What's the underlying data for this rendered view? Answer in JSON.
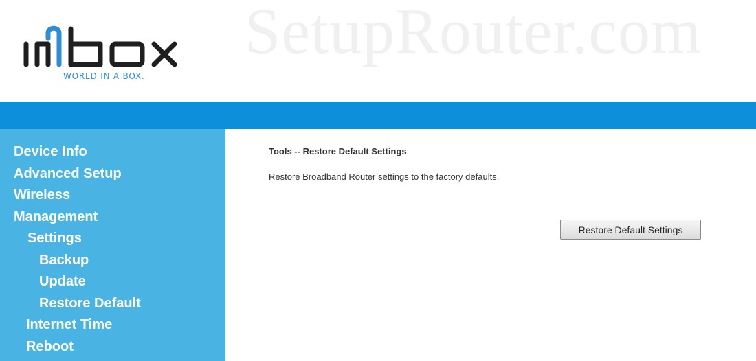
{
  "header": {
    "logo_text": "imbox",
    "tagline": "WORLD IN A BOX.",
    "watermark": "SetupRouter.com"
  },
  "colors": {
    "topbar": "#0d8fda",
    "sidebar": "#49b4e4",
    "logo_dark": "#1f1f1f",
    "logo_accent": "#2f8dd4"
  },
  "sidebar": {
    "items": [
      {
        "label": "Device Info",
        "level": 0
      },
      {
        "label": "Advanced Setup",
        "level": 0
      },
      {
        "label": "Wireless",
        "level": 0
      },
      {
        "label": "Management",
        "level": 0
      },
      {
        "label": "Settings",
        "level": 1
      },
      {
        "label": "Backup",
        "level": 2
      },
      {
        "label": "Update",
        "level": 2
      },
      {
        "label": "Restore Default",
        "level": 2
      },
      {
        "label": "Internet Time",
        "level": 1
      },
      {
        "label": "Reboot",
        "level": 1
      }
    ]
  },
  "main": {
    "title": "Tools -- Restore Default Settings",
    "description": "Restore Broadband Router settings to the factory defaults.",
    "button_label": "Restore Default Settings"
  }
}
